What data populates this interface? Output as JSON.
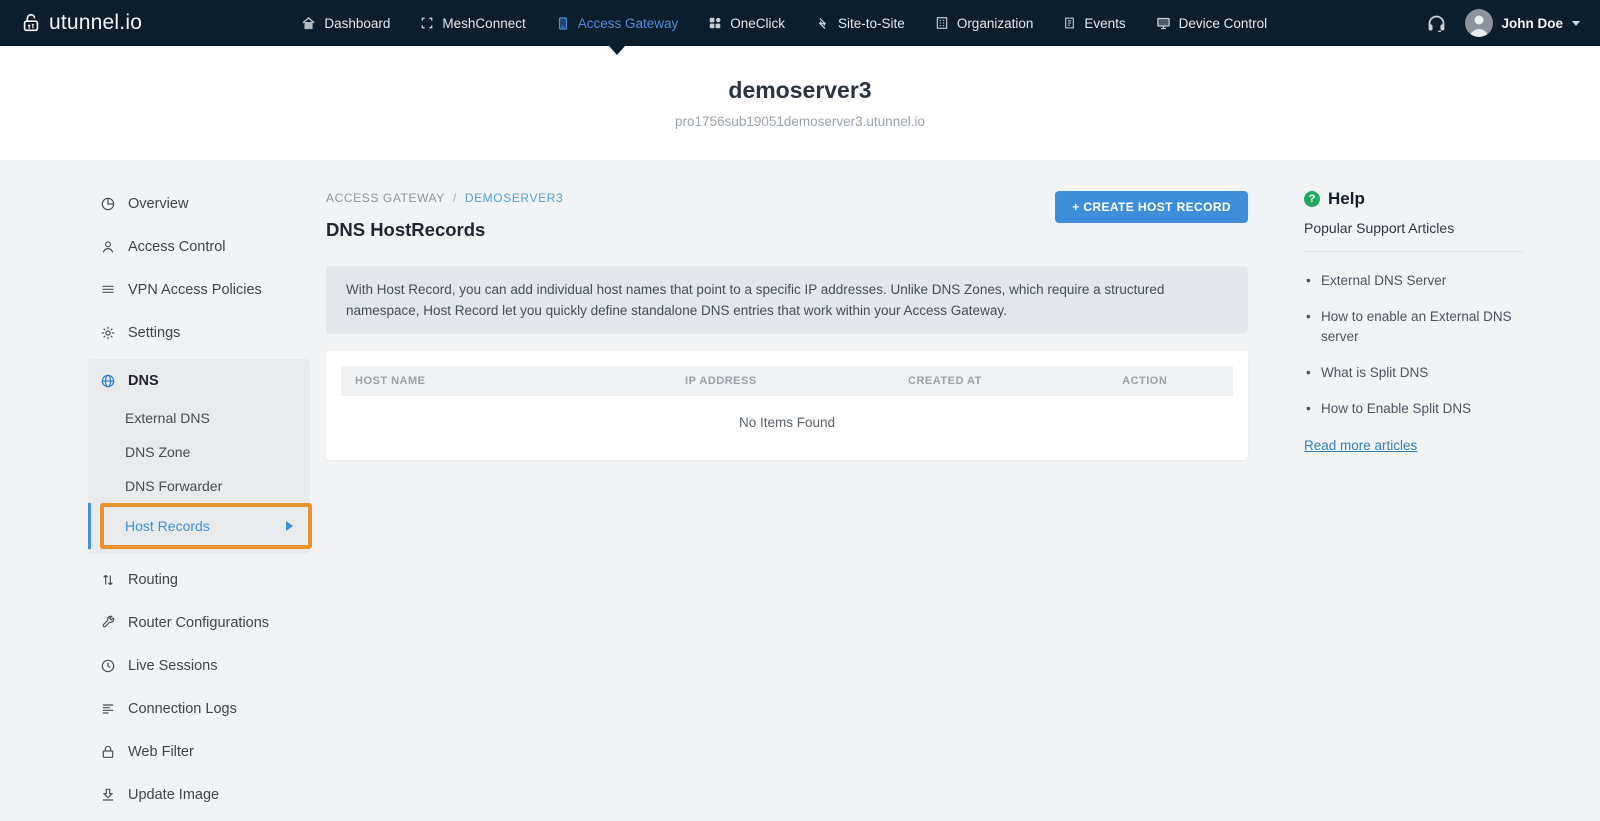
{
  "brand": {
    "name": "utunnel.io",
    "icon": "lock-logo-icon"
  },
  "navbar": {
    "items": [
      {
        "label": "Dashboard",
        "icon": "home-icon"
      },
      {
        "label": "MeshConnect",
        "icon": "mesh-icon"
      },
      {
        "label": "Access Gateway",
        "icon": "gateway-icon",
        "active": true
      },
      {
        "label": "OneClick",
        "icon": "oneclick-grid-icon"
      },
      {
        "label": "Site-to-Site",
        "icon": "site-to-site-arrows-icon"
      },
      {
        "label": "Organization",
        "icon": "building-icon"
      },
      {
        "label": "Events",
        "icon": "events-list-icon"
      },
      {
        "label": "Device Control",
        "icon": "monitor-icon"
      }
    ],
    "support_icon": "headset-icon",
    "user": {
      "name": "John Doe",
      "icon": "avatar"
    }
  },
  "server_header": {
    "title": "demoserver3",
    "subtitle": "pro1756sub19051demoserver3.utunnel.io"
  },
  "sidebar": {
    "items_upper": [
      {
        "label": "Overview",
        "icon": "pie-chart-icon"
      },
      {
        "label": "Access Control",
        "icon": "person-icon"
      },
      {
        "label": "VPN Access Policies",
        "icon": "list-bars-icon"
      },
      {
        "label": "Settings",
        "icon": "gear-icon"
      }
    ],
    "dns_group": {
      "label": "DNS",
      "icon": "globe-icon",
      "children": [
        {
          "label": "External DNS"
        },
        {
          "label": "DNS Zone"
        },
        {
          "label": "DNS Forwarder"
        },
        {
          "label": "Host Records",
          "active": true,
          "annotated": true
        }
      ]
    },
    "items_lower": [
      {
        "label": "Routing",
        "icon": "routing-arrows-icon"
      },
      {
        "label": "Router Configurations",
        "icon": "wrench-icon"
      },
      {
        "label": "Live Sessions",
        "icon": "clock-icon"
      },
      {
        "label": "Connection Logs",
        "icon": "log-lines-icon"
      },
      {
        "label": "Web Filter",
        "icon": "lock-icon"
      },
      {
        "label": "Update Image",
        "icon": "download-icon"
      }
    ]
  },
  "main": {
    "breadcrumb": {
      "parent": "ACCESS GATEWAY",
      "separator": "/",
      "current": "DEMOSERVER3"
    },
    "page_title": "DNS HostRecords",
    "create_button": "+ CREATE HOST RECORD",
    "info_text": "With Host Record, you can add individual host names that point to a specific IP addresses. Unlike DNS Zones, which require a structured namespace, Host Record let you quickly define standalone DNS entries that work within your Access Gateway.",
    "table": {
      "columns": [
        "HOST NAME",
        "IP ADDRESS",
        "CREATED AT",
        "ACTION"
      ],
      "empty_text": "No Items Found"
    }
  },
  "help": {
    "icon": "question-circle-icon",
    "title": "Help",
    "subtitle": "Popular Support Articles",
    "articles": [
      "External DNS Server",
      "How to enable an External DNS server",
      "What is Split DNS",
      "How to Enable Split DNS"
    ],
    "link": "Read more articles"
  },
  "colors": {
    "navbar_bg": "#0C1D2B",
    "active_nav_blue": "#4A8FE0",
    "accent_blue": "#3E8EDC",
    "annotation_orange": "#E8912D",
    "help_green": "#27A860",
    "link_blue": "#2F80B8"
  }
}
